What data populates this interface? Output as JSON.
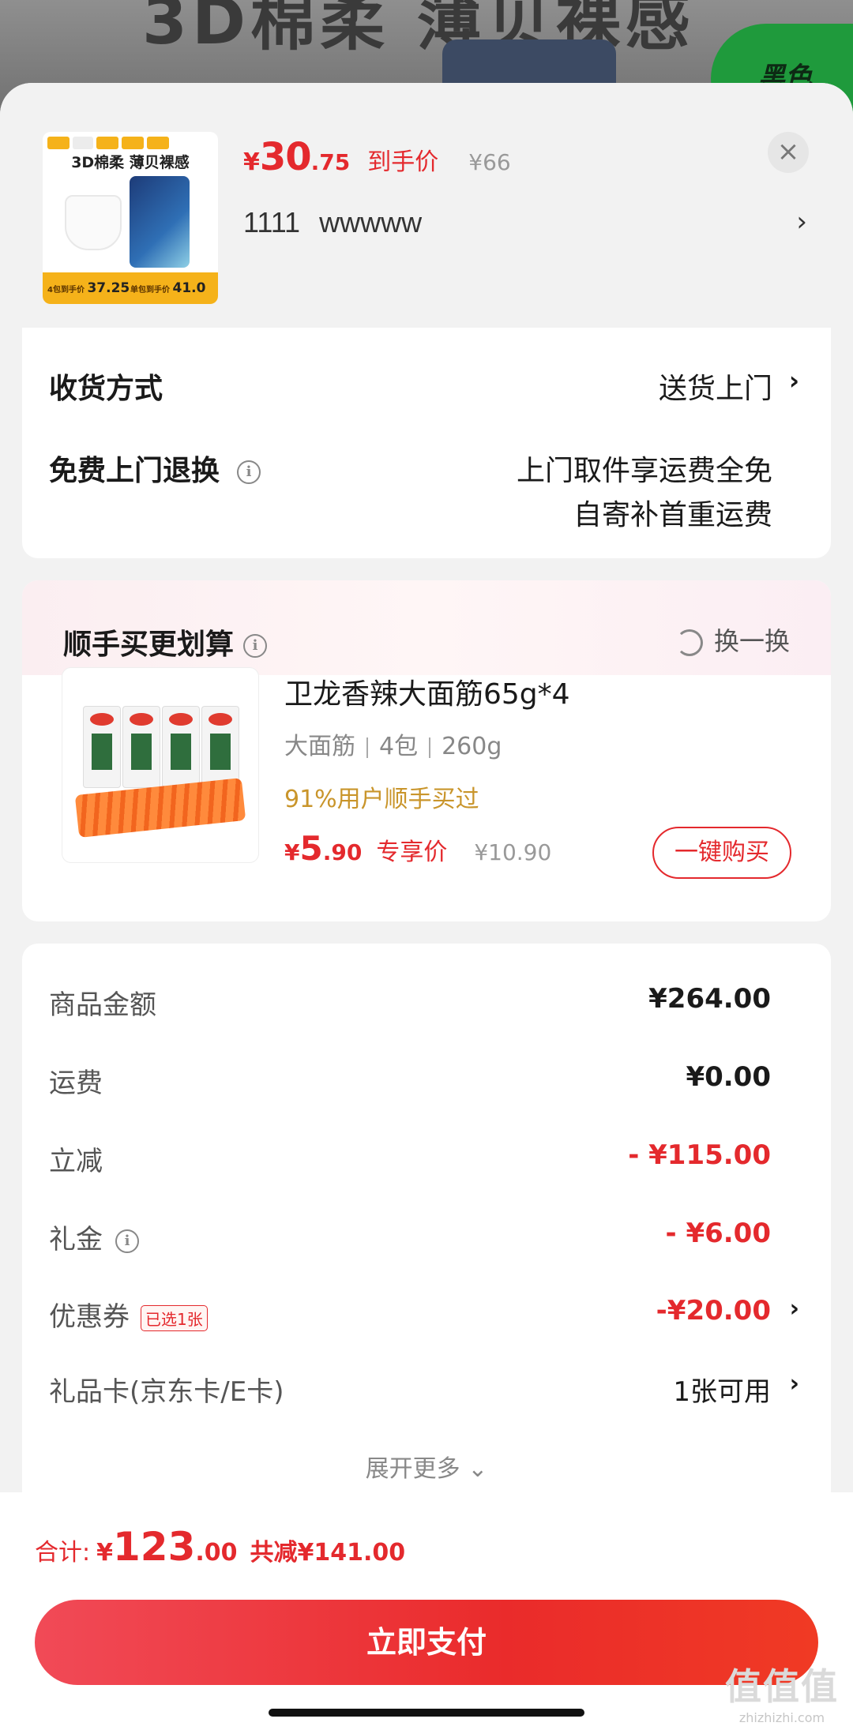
{
  "background": {
    "headline": "3D棉柔 薄贝裸感",
    "badge": "黑色"
  },
  "product": {
    "thumb_title": "3D棉柔 薄贝裸感",
    "thumb_strip_left_label": "4包到手价",
    "thumb_strip_left_price": "37.25",
    "thumb_strip_right_label": "单包到手价",
    "thumb_strip_right_price": "41.0",
    "price_currency": "¥",
    "price_int": "30",
    "price_dec": ".75",
    "price_tag": "到手价",
    "price_original": "¥66",
    "spec_number": "1111",
    "spec_name": "wwwww",
    "close_icon": "close-icon",
    "chevron": "›"
  },
  "delivery": {
    "method_label": "收货方式",
    "method_value": "送货上门",
    "return_label": "免费上门退换",
    "return_line1": "上门取件享运费全免",
    "return_line2": "自寄补首重运费",
    "chevron": "›"
  },
  "upsell": {
    "title": "顺手买更划算",
    "refresh_label": "换一换",
    "name": "卫龙香辣大面筋65g*4",
    "spec_parts": [
      "大面筋",
      "4包",
      "260g"
    ],
    "hint": "91%用户顺手买过",
    "price_currency": "¥",
    "price_int": "5",
    "price_dec": ".90",
    "price_tag": "专享价",
    "price_original": "¥10.90",
    "buy_label": "一键购买"
  },
  "fees": {
    "rows": [
      {
        "label": "商品金额",
        "value": "¥264.00"
      },
      {
        "label": "运费",
        "value": "¥0.00"
      },
      {
        "label": "立减",
        "value": "- ¥115.00"
      },
      {
        "label": "礼金",
        "value": "- ¥6.00"
      },
      {
        "label": "优惠券",
        "tag": "已选1张",
        "value": "-¥20.00"
      },
      {
        "label": "礼品卡(京东卡/E卡)",
        "value": "1张可用"
      }
    ],
    "expand_label": "展开更多",
    "chevron": "›"
  },
  "bottom": {
    "total_label": "合计:",
    "total_currency": "¥",
    "total_int": "123",
    "total_dec": ".00",
    "saved_label": "共减¥141.00",
    "pay_label": "立即支付"
  },
  "watermark": {
    "text": "值值值",
    "url": "zhizhizhi.com"
  },
  "colors": {
    "accent_red": "#e4292d",
    "hint_gold": "#c9952b"
  }
}
